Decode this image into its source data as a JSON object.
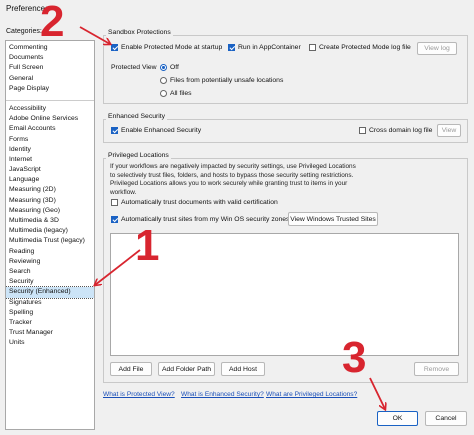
{
  "window": {
    "title": "Preferences"
  },
  "categories": {
    "label": "Categories:",
    "top_items": [
      "Commenting",
      "Documents",
      "Full Screen",
      "General",
      "Page Display"
    ],
    "items": [
      "Accessibility",
      "Adobe Online Services",
      "Email Accounts",
      "Forms",
      "Identity",
      "Internet",
      "JavaScript",
      "Language",
      "Measuring (2D)",
      "Measuring (3D)",
      "Measuring (Geo)",
      "Multimedia & 3D",
      "Multimedia (legacy)",
      "Multimedia Trust (legacy)",
      "Reading",
      "Reviewing",
      "Search",
      "Security",
      "Security (Enhanced)",
      "Signatures",
      "Spelling",
      "Tracker",
      "Trust Manager",
      "Units"
    ],
    "selected": "Security (Enhanced)"
  },
  "sandbox": {
    "title": "Sandbox Protections",
    "protected_mode": "Enable Protected Mode at startup",
    "app_container": "Run in AppContainer",
    "log_file": "Create Protected Mode log file",
    "view_log": "View log",
    "protected_view_label": "Protected View",
    "pv_off": "Off",
    "pv_unsafe": "Files from potentially unsafe locations",
    "pv_all": "All files"
  },
  "enhanced": {
    "title": "Enhanced Security",
    "enable": "Enable Enhanced Security",
    "cross_domain": "Cross domain log file",
    "view": "View"
  },
  "privileged": {
    "title": "Privileged Locations",
    "description": "If your workflows are negatively impacted by security settings, use Privileged Locations to selectively trust files, folders, and hosts to bypass those security setting restrictions. Privileged Locations allows you to work securely while granting trust to items in your workflow.",
    "auto_trust_cert": "Automatically trust documents with valid certification",
    "auto_trust_win": "Automatically trust sites from my Win OS security zones",
    "view_trusted": "View Windows Trusted Sites",
    "add_file": "Add File",
    "add_folder": "Add Folder Path",
    "add_host": "Add Host",
    "remove": "Remove"
  },
  "links": {
    "what_protected": "What is Protected View?",
    "what_enhanced": "What is Enhanced Security?",
    "what_privileged": "What are Privileged Locations?"
  },
  "footer": {
    "ok": "OK",
    "cancel": "Cancel"
  },
  "annotations": {
    "one": "1",
    "two": "2",
    "three": "3"
  },
  "colors": {
    "annotation_red": "#d8252f",
    "accent_blue": "#1a62c4"
  }
}
